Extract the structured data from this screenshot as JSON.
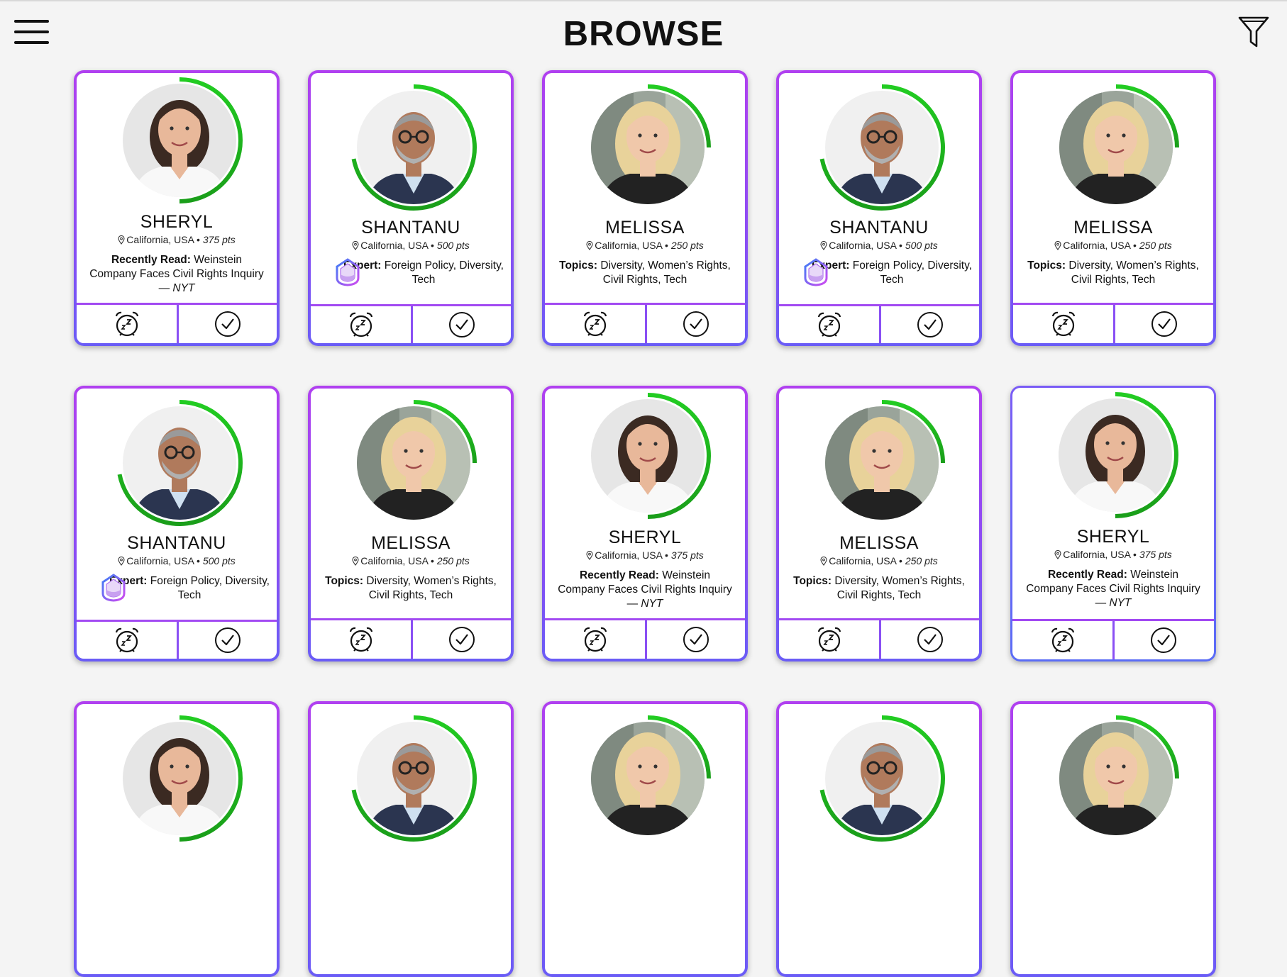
{
  "header": {
    "title": "BROWSE",
    "menu_icon": "hamburger-menu-icon",
    "filter_icon": "filter-funnel-icon"
  },
  "colors": {
    "card_border_top": "#b040f0",
    "card_border_bottom": "#6a5cf6",
    "progress_ring": "#1a9e1a",
    "progress_ring_light": "#22cc22"
  },
  "location": "California, USA",
  "cards": [
    {
      "name": "SHERYL",
      "pts": "375 pts",
      "label": "Recently Read:",
      "text": "Weinstein Company Faces Civil Rights Inquiry —",
      "source": "NYT",
      "type": "read",
      "person": "sheryl",
      "progress": 0.5
    },
    {
      "name": "SHANTANU",
      "pts": "500 pts",
      "label": "Expert:",
      "text": "Foreign Policy, Diversity, Tech",
      "type": "expert",
      "person": "shantanu",
      "progress": 0.72
    },
    {
      "name": "MELISSA",
      "pts": "250 pts",
      "label": "Topics:",
      "text": "Diversity, Women’s Rights, Civil Rights, Tech",
      "type": "topics",
      "person": "melissa",
      "progress": 0.25
    },
    {
      "name": "SHANTANU",
      "pts": "500 pts",
      "label": "Expert:",
      "text": "Foreign Policy, Diversity, Tech",
      "type": "expert",
      "person": "shantanu",
      "progress": 0.72
    },
    {
      "name": "MELISSA",
      "pts": "250 pts",
      "label": "Topics:",
      "text": "Diversity, Women’s Rights, Civil Rights, Tech",
      "type": "topics",
      "person": "melissa",
      "progress": 0.25
    },
    {
      "name": "SHANTANU",
      "pts": "500 pts",
      "label": "Expert:",
      "text": "Foreign Policy, Diversity, Tech",
      "type": "expert",
      "person": "shantanu",
      "progress": 0.72
    },
    {
      "name": "MELISSA",
      "pts": "250 pts",
      "label": "Topics:",
      "text": "Diversity, Women’s Rights, Civil Rights, Tech",
      "type": "topics",
      "person": "melissa",
      "progress": 0.25
    },
    {
      "name": "SHERYL",
      "pts": "375 pts",
      "label": "Recently Read:",
      "text": "Weinstein Company Faces Civil Rights Inquiry —",
      "source": "NYT",
      "type": "read",
      "person": "sheryl",
      "progress": 0.5
    },
    {
      "name": "MELISSA",
      "pts": "250 pts",
      "label": "Topics:",
      "text": "Diversity, Women’s Rights, Civil Rights, Tech",
      "type": "topics",
      "person": "melissa",
      "progress": 0.25
    },
    {
      "name": "SHERYL",
      "pts": "375 pts",
      "label": "Recently Read:",
      "text": "Weinstein Company Faces Civil Rights Inquiry —",
      "source": "NYT",
      "type": "read",
      "person": "sheryl",
      "progress": 0.5,
      "selected": true
    },
    {
      "person": "sheryl",
      "progress": 0.5,
      "partial": true
    },
    {
      "person": "shantanu",
      "progress": 0.72,
      "partial": true
    },
    {
      "person": "melissa",
      "progress": 0.25,
      "partial": true
    },
    {
      "person": "shantanu",
      "progress": 0.72,
      "partial": true
    },
    {
      "person": "melissa",
      "progress": 0.25,
      "partial": true
    }
  ],
  "actions": {
    "snooze_icon": "snooze-alarm-clock-icon",
    "accept_icon": "checkmark-circle-icon"
  }
}
